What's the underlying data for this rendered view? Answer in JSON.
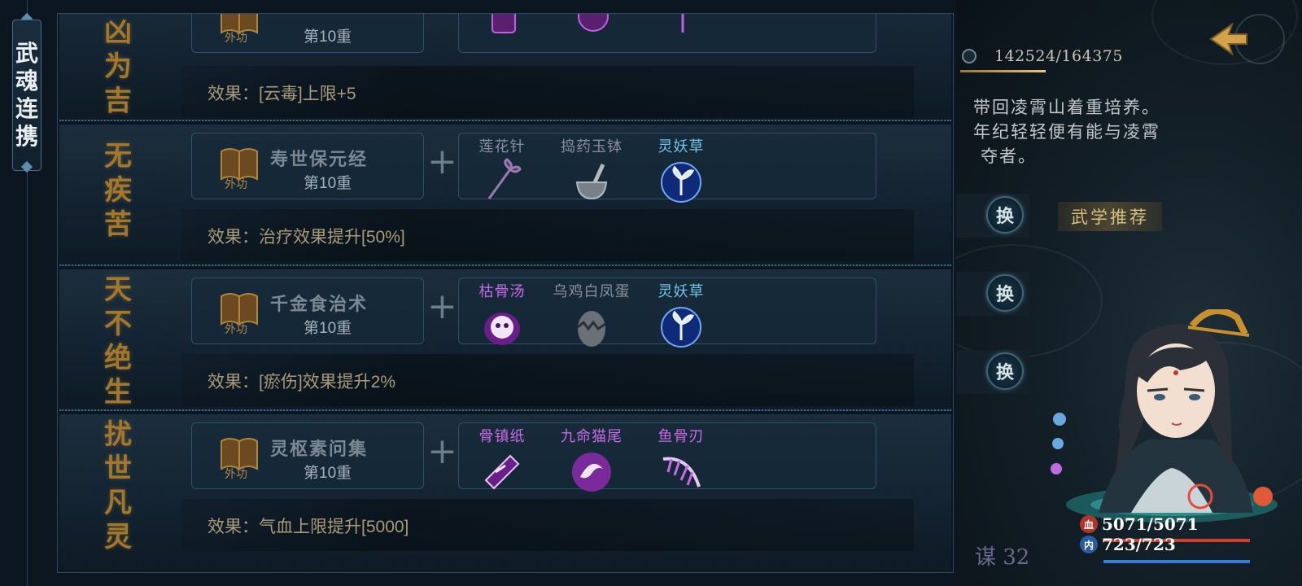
{
  "side_tab": {
    "chars": [
      "武",
      "魂",
      "连",
      "携"
    ]
  },
  "combos": [
    {
      "name_chars": [
        "凶",
        "为",
        "吉"
      ],
      "book": {
        "type": "外功",
        "name": "",
        "level": "第10重"
      },
      "materials": [
        {
          "label": "",
          "icon": "scroll-icon",
          "color": "#c060e0"
        },
        {
          "label": "",
          "icon": "dragon-icon",
          "color": "#c060e0"
        },
        {
          "label": "",
          "icon": "flower-icon",
          "color": "#c060e0"
        }
      ],
      "effect": "效果：[云毒]上限+5"
    },
    {
      "name_chars": [
        "无",
        "疾",
        "苦"
      ],
      "book": {
        "type": "外功",
        "name": "寿世保元经",
        "level": "第10重"
      },
      "materials": [
        {
          "label": "莲花针",
          "icon": "lotus-needle-icon",
          "color": "#8a8f98"
        },
        {
          "label": "捣药玉钵",
          "icon": "mortar-icon",
          "color": "#8a8f98"
        },
        {
          "label": "灵妖草",
          "icon": "spirit-herb-icon",
          "color": "#6fc6ea"
        }
      ],
      "effect": "效果：治疗效果提升[50%]"
    },
    {
      "name_chars": [
        "天",
        "不",
        "绝",
        "生"
      ],
      "book": {
        "type": "外功",
        "name": "千金食治术",
        "level": "第10重"
      },
      "materials": [
        {
          "label": "枯骨汤",
          "icon": "skull-soup-icon",
          "color": "#c86ae6"
        },
        {
          "label": "乌鸡白凤蛋",
          "icon": "egg-icon",
          "color": "#8a8f98"
        },
        {
          "label": "灵妖草",
          "icon": "spirit-herb-icon",
          "color": "#6fc6ea"
        }
      ],
      "effect": "效果：[瘀伤]效果提升2%"
    },
    {
      "name_chars": [
        "扰",
        "世",
        "凡",
        "灵"
      ],
      "book": {
        "type": "外功",
        "name": "灵枢素问集",
        "level": "第10重"
      },
      "materials": [
        {
          "label": "骨镇纸",
          "icon": "bone-paperweight-icon",
          "color": "#c86ae6"
        },
        {
          "label": "九命猫尾",
          "icon": "cat-tail-icon",
          "color": "#c86ae6"
        },
        {
          "label": "鱼骨刃",
          "icon": "fishbone-blade-icon",
          "color": "#c86ae6"
        }
      ],
      "effect": "效果：气血上限提升[5000]"
    }
  ],
  "right_panel": {
    "exp": "142524/164375",
    "bio_lines": [
      "带回凌霄山着重培养。",
      "年纪轻轻便有能与凌霄",
      "夺者。"
    ],
    "swap_label": "换",
    "recommend_label": "武学推荐",
    "bottom_tag": "谋 32",
    "hp": {
      "icon": "血",
      "text": "5071/5071",
      "fraction": 1.0,
      "color": "#c0392b"
    },
    "mp": {
      "icon": "内",
      "text": "723/723",
      "fraction": 1.0,
      "color": "#3a7bd5"
    }
  }
}
